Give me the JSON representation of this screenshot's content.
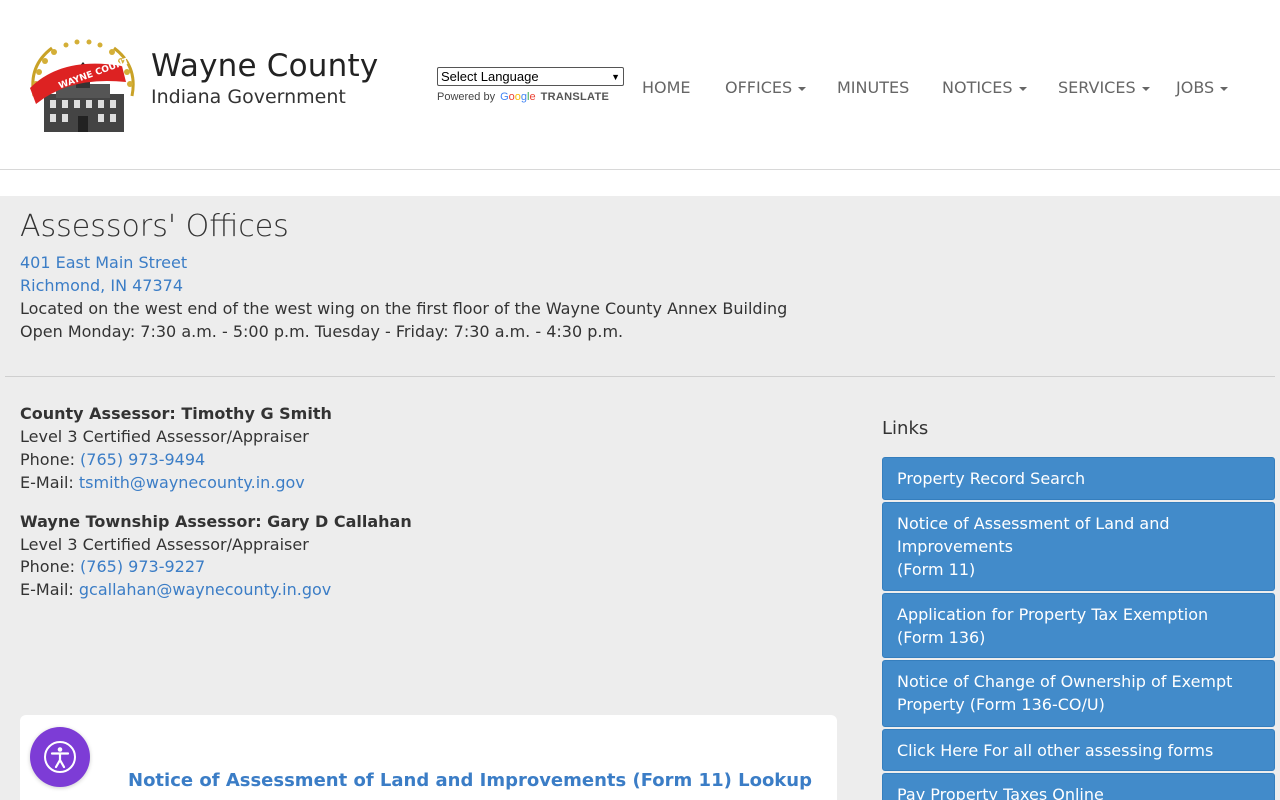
{
  "brand": {
    "name": "Wayne County",
    "subtitle": "Indiana Government",
    "logo_banner_text": "WAYNE COUNTY"
  },
  "translate": {
    "select_label": "Select Language",
    "powered_by": "Powered by",
    "google": [
      "G",
      "o",
      "o",
      "g",
      "l",
      "e"
    ],
    "translate": "TRANSLATE"
  },
  "nav": {
    "home": "HOME",
    "offices": "OFFICES",
    "minutes": "MINUTES",
    "notices": "NOTICES",
    "services": "SERVICES",
    "jobs": "JOBS"
  },
  "office": {
    "title": "Assessors' Offices",
    "street": "401 East Main Street",
    "city": "Richmond, IN 47374",
    "location": "Located on the west end of the west wing on the first floor of the Wayne County Annex Building",
    "hours": "Open Monday: 7:30 a.m. - 5:00 p.m. Tuesday - Friday: 7:30 a.m. - 4:30 p.m."
  },
  "contacts": [
    {
      "heading": "County Assessor: Timothy G Smith",
      "certification": "Level 3 Certified Assessor/Appraiser",
      "phone_label": "Phone:",
      "phone": "(765) 973-9494",
      "email_label": "E-Mail:",
      "email": "tsmith@waynecounty.in.gov"
    },
    {
      "heading": "Wayne Township Assessor: Gary D Callahan",
      "certification": "Level 3 Certified Assessor/Appraiser",
      "phone_label": "Phone:",
      "phone": "(765) 973-9227",
      "email_label": "E-Mail:",
      "email": "gcallahan@waynecounty.in.gov"
    }
  ],
  "links": {
    "heading": "Links",
    "items": [
      "Property Record Search",
      "Notice of Assessment of Land and Improvements",
      "(Form 11)",
      "Application for Property Tax Exemption",
      "(Form 136)",
      "Notice of Change of Ownership of Exempt Property (Form 136-CO/U)",
      "Click Here For all other assessing forms",
      "Pay Property Taxes Online"
    ]
  },
  "card": {
    "title": "Notice of Assessment of Land and Improvements (Form 11) Lookup"
  },
  "colors": {
    "link_blue": "#3b7dc6",
    "button_blue": "#428bca",
    "band_gray": "#ededed",
    "a11y_purple": "#7d3cd6"
  }
}
